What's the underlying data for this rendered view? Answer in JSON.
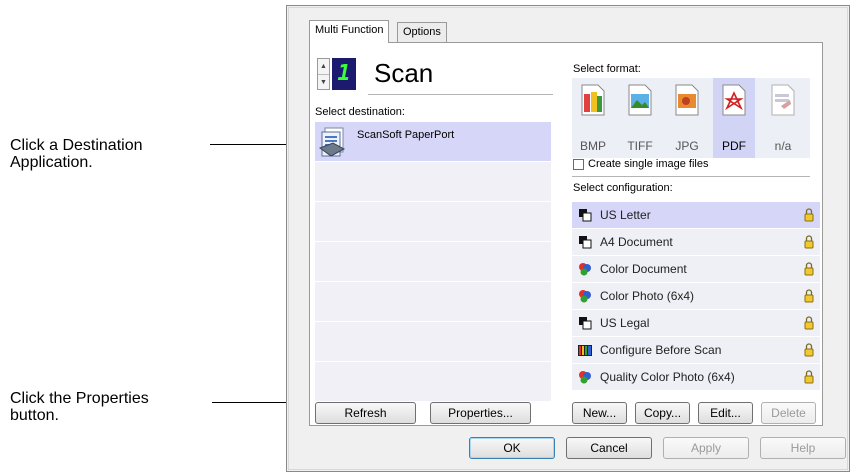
{
  "callouts": {
    "destination": {
      "line1": "Click a Destination",
      "line2": "Application."
    },
    "properties": {
      "line1": "Click the Properties",
      "line2": "button."
    }
  },
  "tabs": [
    {
      "label": "Multi Function",
      "active": true
    },
    {
      "label": "Options",
      "active": false
    }
  ],
  "scan": {
    "number": "1",
    "title": "Scan"
  },
  "destination": {
    "label": "Select destination:",
    "items": [
      {
        "name": "ScanSoft PaperPort",
        "icon": "paperport-icon",
        "selected": true
      }
    ]
  },
  "format": {
    "label": "Select format:",
    "items": [
      {
        "label": "BMP",
        "icon": "bmp-file-icon",
        "selected": false
      },
      {
        "label": "TIFF",
        "icon": "tiff-file-icon",
        "selected": false
      },
      {
        "label": "JPG",
        "icon": "jpg-file-icon",
        "selected": false
      },
      {
        "label": "PDF",
        "icon": "pdf-file-icon",
        "selected": true
      },
      {
        "label": "n/a",
        "icon": "na-file-icon",
        "selected": false
      }
    ],
    "single_image_files": {
      "label": "Create single image files",
      "checked": false
    }
  },
  "configuration": {
    "label": "Select configuration:",
    "items": [
      {
        "name": "US Letter",
        "icon": "black-white-icon",
        "selected": true
      },
      {
        "name": "A4 Document",
        "icon": "black-white-icon",
        "selected": false
      },
      {
        "name": "Color Document",
        "icon": "color-icon",
        "selected": false
      },
      {
        "name": "Color Photo (6x4)",
        "icon": "color-icon",
        "selected": false
      },
      {
        "name": "US Legal",
        "icon": "black-white-icon",
        "selected": false
      },
      {
        "name": "Configure Before Scan",
        "icon": "configure-before-scan-icon",
        "selected": false
      },
      {
        "name": "Quality Color Photo (6x4)",
        "icon": "color-icon",
        "selected": false
      }
    ]
  },
  "buttons": {
    "refresh": "Refresh",
    "properties": "Properties...",
    "new": "New...",
    "copy": "Copy...",
    "edit": "Edit...",
    "delete": "Delete",
    "ok": "OK",
    "cancel": "Cancel",
    "apply": "Apply",
    "help": "Help"
  },
  "colors": {
    "selection": "#d6d7f8",
    "digit_bg": "#1c1a6e",
    "digit_fg": "#3cff3c"
  }
}
